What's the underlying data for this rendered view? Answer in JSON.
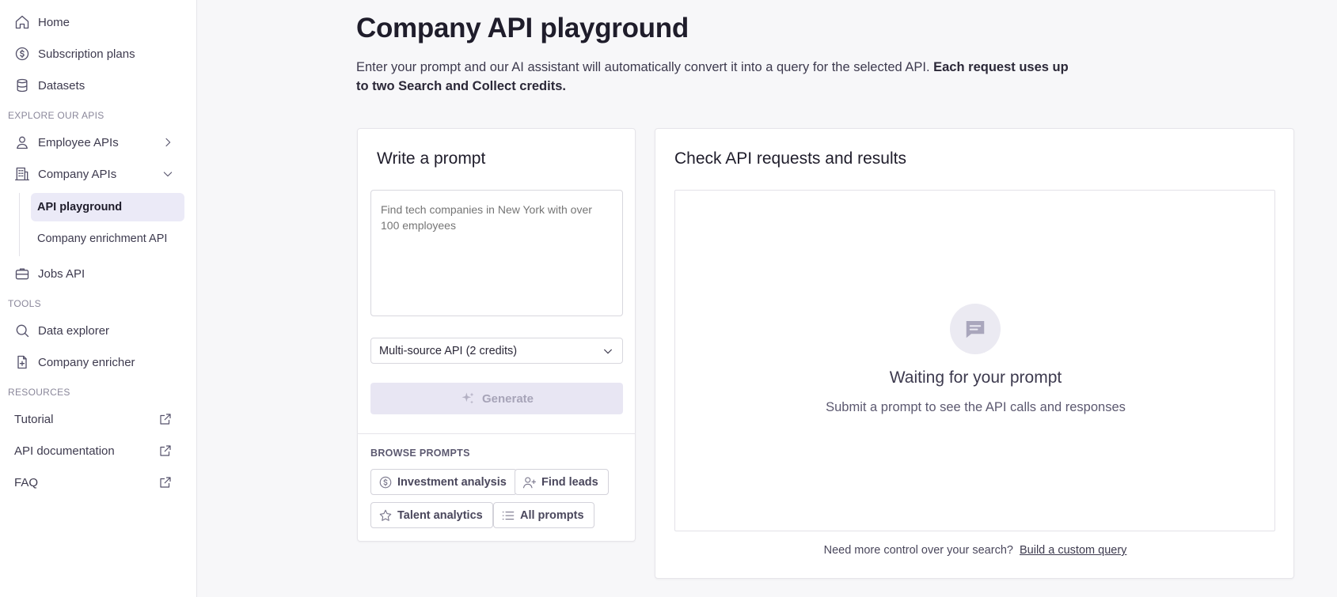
{
  "sidebar": {
    "home": "Home",
    "subscription_plans": "Subscription plans",
    "datasets": "Datasets",
    "explore_label": "EXPLORE OUR APIS",
    "employee_apis": "Employee APIs",
    "company_apis": "Company APIs",
    "api_playground": "API playground",
    "company_enrichment_api": "Company enrichment API",
    "jobs_api": "Jobs API",
    "tools_label": "TOOLS",
    "data_explorer": "Data explorer",
    "company_enricher": "Company enricher",
    "resources_label": "RESOURCES",
    "tutorial": "Tutorial",
    "api_documentation": "API documentation",
    "faq": "FAQ"
  },
  "main": {
    "title": "Company API playground",
    "intro_text": "Enter your prompt and our AI assistant will automatically convert it into a query for the selected API.",
    "intro_bold": "Each request uses up to two Search and Collect credits."
  },
  "prompt_card": {
    "title": "Write a prompt",
    "placeholder": "Find tech companies in New York with over 100 employees",
    "selected_api": "Multi-source API (2 credits)",
    "generate_label": "Generate",
    "browse_label": "BROWSE PROMPTS",
    "chips": [
      "Investment analysis",
      "Find leads",
      "Talent analytics",
      "All prompts"
    ]
  },
  "results_card": {
    "title": "Check API requests and results",
    "waiting_title": "Waiting for your prompt",
    "waiting_sub": "Submit a prompt to see the API calls and responses",
    "footer_text": "Need more control over your search?",
    "footer_link": "Build a custom query"
  },
  "colors": {
    "accent_active_bg": "#ebeaf7",
    "generate_disabled_bg": "#e8e6f3"
  }
}
